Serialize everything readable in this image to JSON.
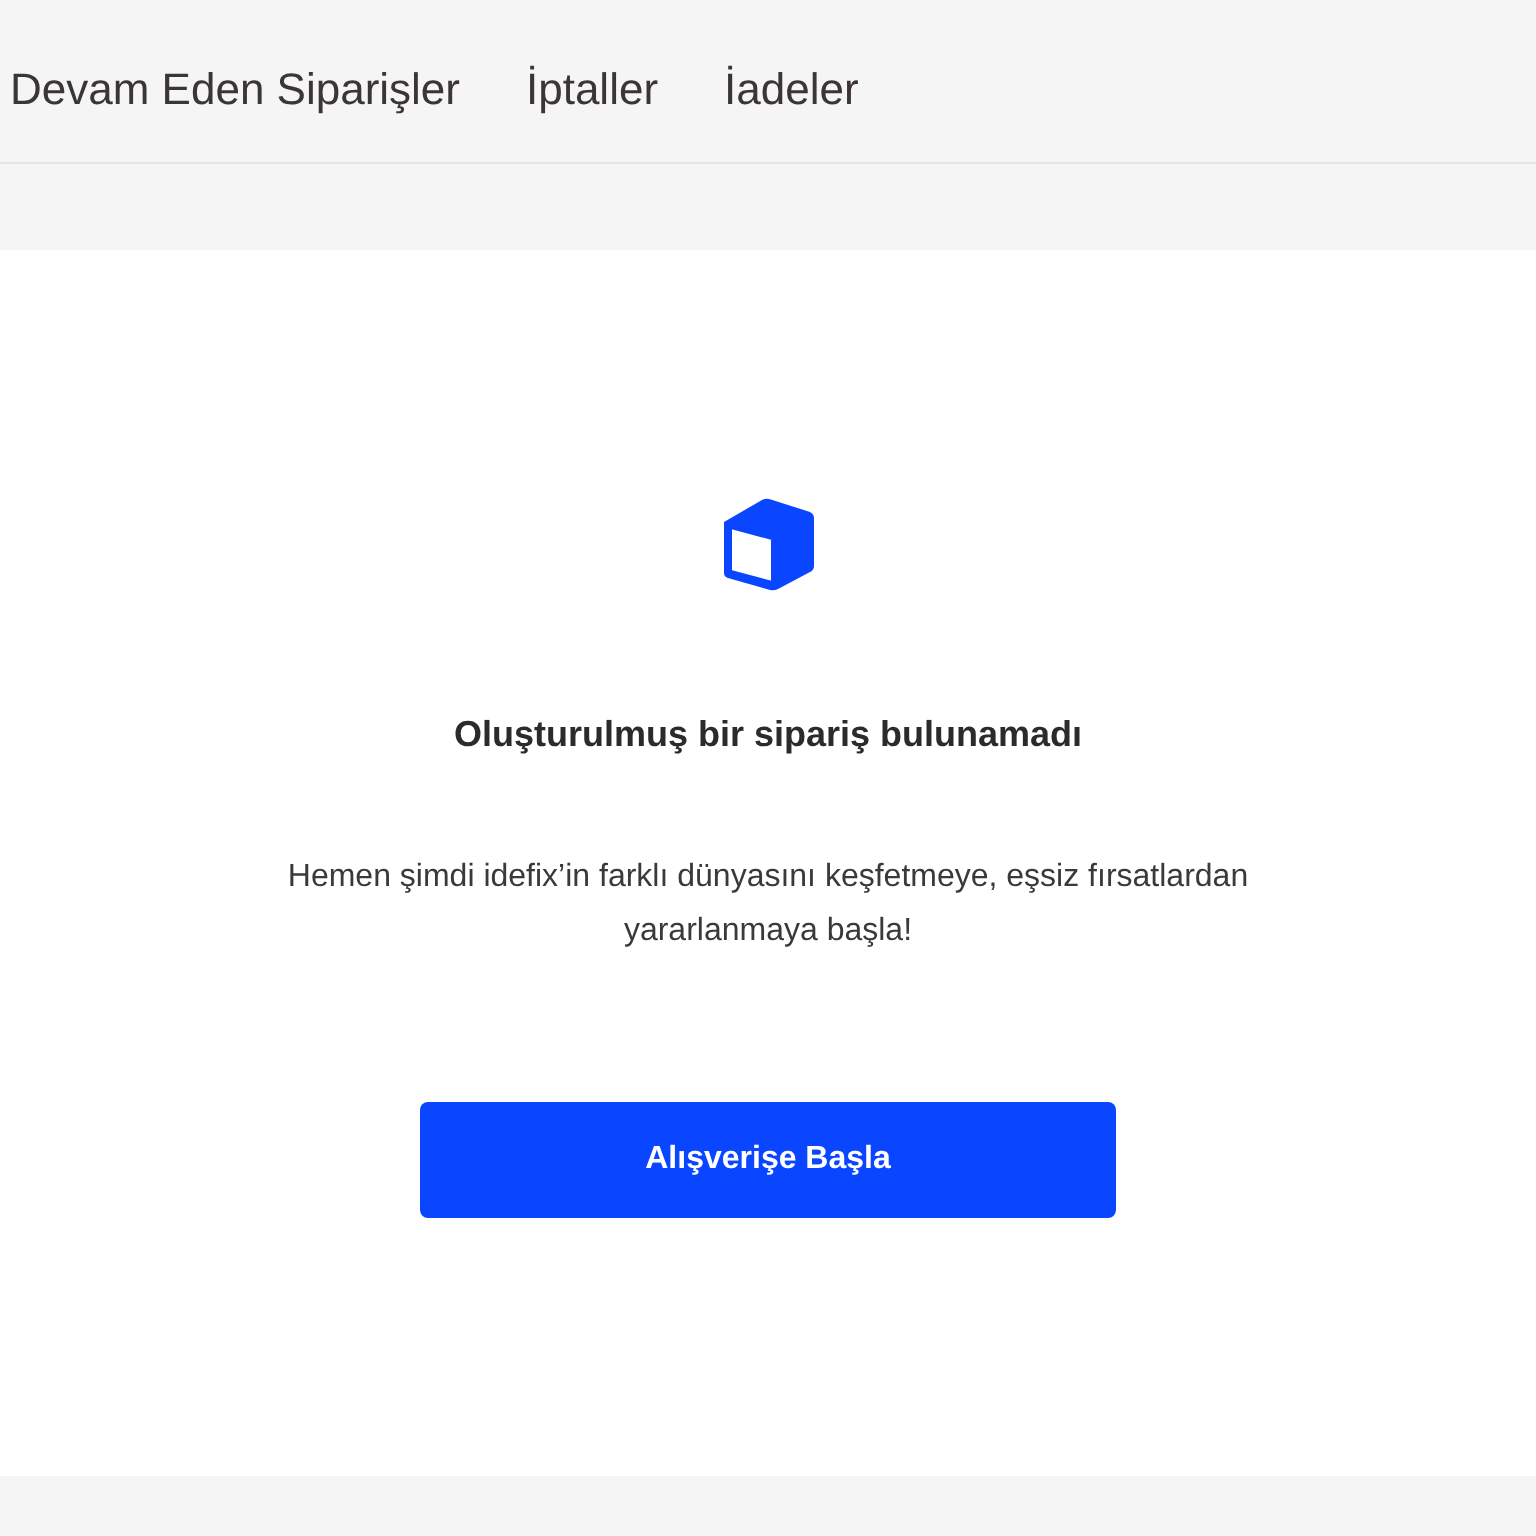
{
  "tabs": [
    {
      "label": "Devam Eden Siparişler"
    },
    {
      "label": "İptaller"
    },
    {
      "label": "İadeler"
    }
  ],
  "empty_state": {
    "title": "Oluşturulmuş bir sipariş bulunamadı",
    "message": "Hemen şimdi idefix’in farklı dünyasını keşfetmeye, eşsiz fırsatlardan yararlanmaya başla!",
    "button": "Alışverişe Başla"
  }
}
